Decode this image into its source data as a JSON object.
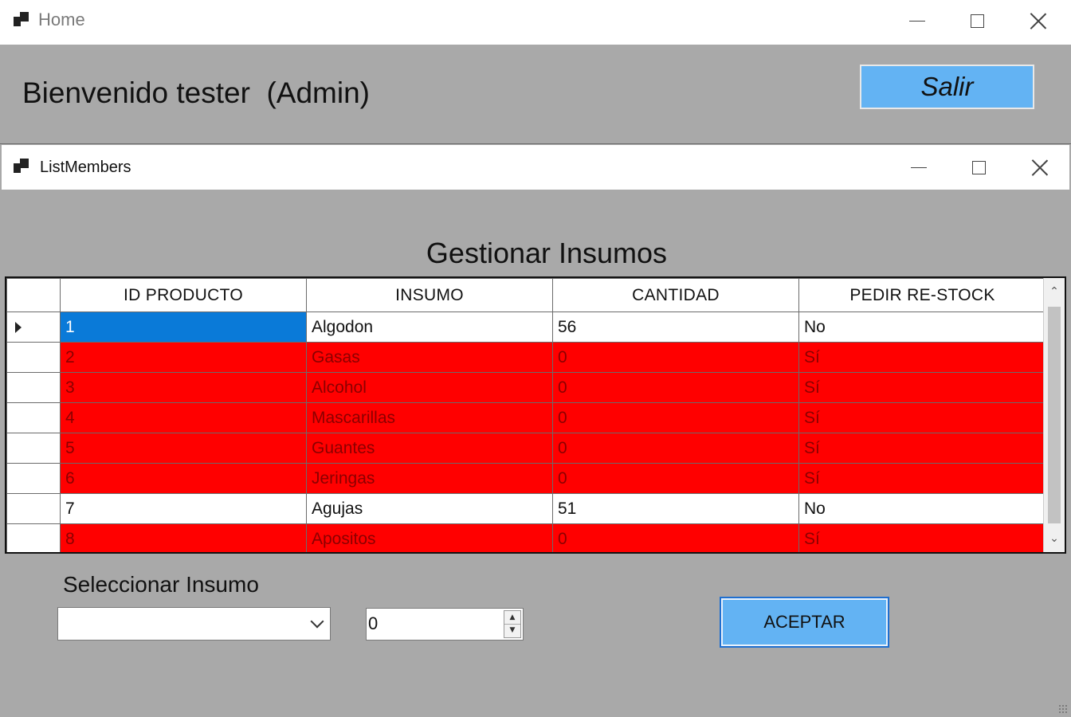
{
  "home_window": {
    "title": "Home",
    "welcome_text": "Bienvenido tester  (Admin)",
    "salir_label": "Salir"
  },
  "child_window": {
    "title": "ListMembers",
    "heading": "Gestionar Insumos"
  },
  "grid": {
    "columns": [
      "ID PRODUCTO",
      "INSUMO",
      "CANTIDAD",
      "PEDIR RE-STOCK"
    ],
    "rows": [
      {
        "id": "1",
        "insumo": "Algodon",
        "cantidad": "56",
        "restock": "No",
        "highlight": false,
        "current": true
      },
      {
        "id": "2",
        "insumo": "Gasas",
        "cantidad": "0",
        "restock": "Sí",
        "highlight": true,
        "current": false
      },
      {
        "id": "3",
        "insumo": "Alcohol",
        "cantidad": "0",
        "restock": "Sí",
        "highlight": true,
        "current": false
      },
      {
        "id": "4",
        "insumo": "Mascarillas",
        "cantidad": "0",
        "restock": "Sí",
        "highlight": true,
        "current": false
      },
      {
        "id": "5",
        "insumo": "Guantes",
        "cantidad": "0",
        "restock": "Sí",
        "highlight": true,
        "current": false
      },
      {
        "id": "6",
        "insumo": "Jeringas",
        "cantidad": "0",
        "restock": "Sí",
        "highlight": true,
        "current": false
      },
      {
        "id": "7",
        "insumo": "Agujas",
        "cantidad": "51",
        "restock": "No",
        "highlight": false,
        "current": false
      },
      {
        "id": "8",
        "insumo": "Apositos",
        "cantidad": "0",
        "restock": "Sí",
        "highlight": true,
        "current": false
      }
    ]
  },
  "controls": {
    "select_label": "Seleccionar Insumo",
    "combo_value": "",
    "quantity_value": "0",
    "aceptar_label": "ACEPTAR"
  },
  "colors": {
    "background": "#a9a9a9",
    "button_blue": "#63b3f3",
    "restock_red": "#ff0000",
    "selection_blue": "#0a7ad8"
  }
}
